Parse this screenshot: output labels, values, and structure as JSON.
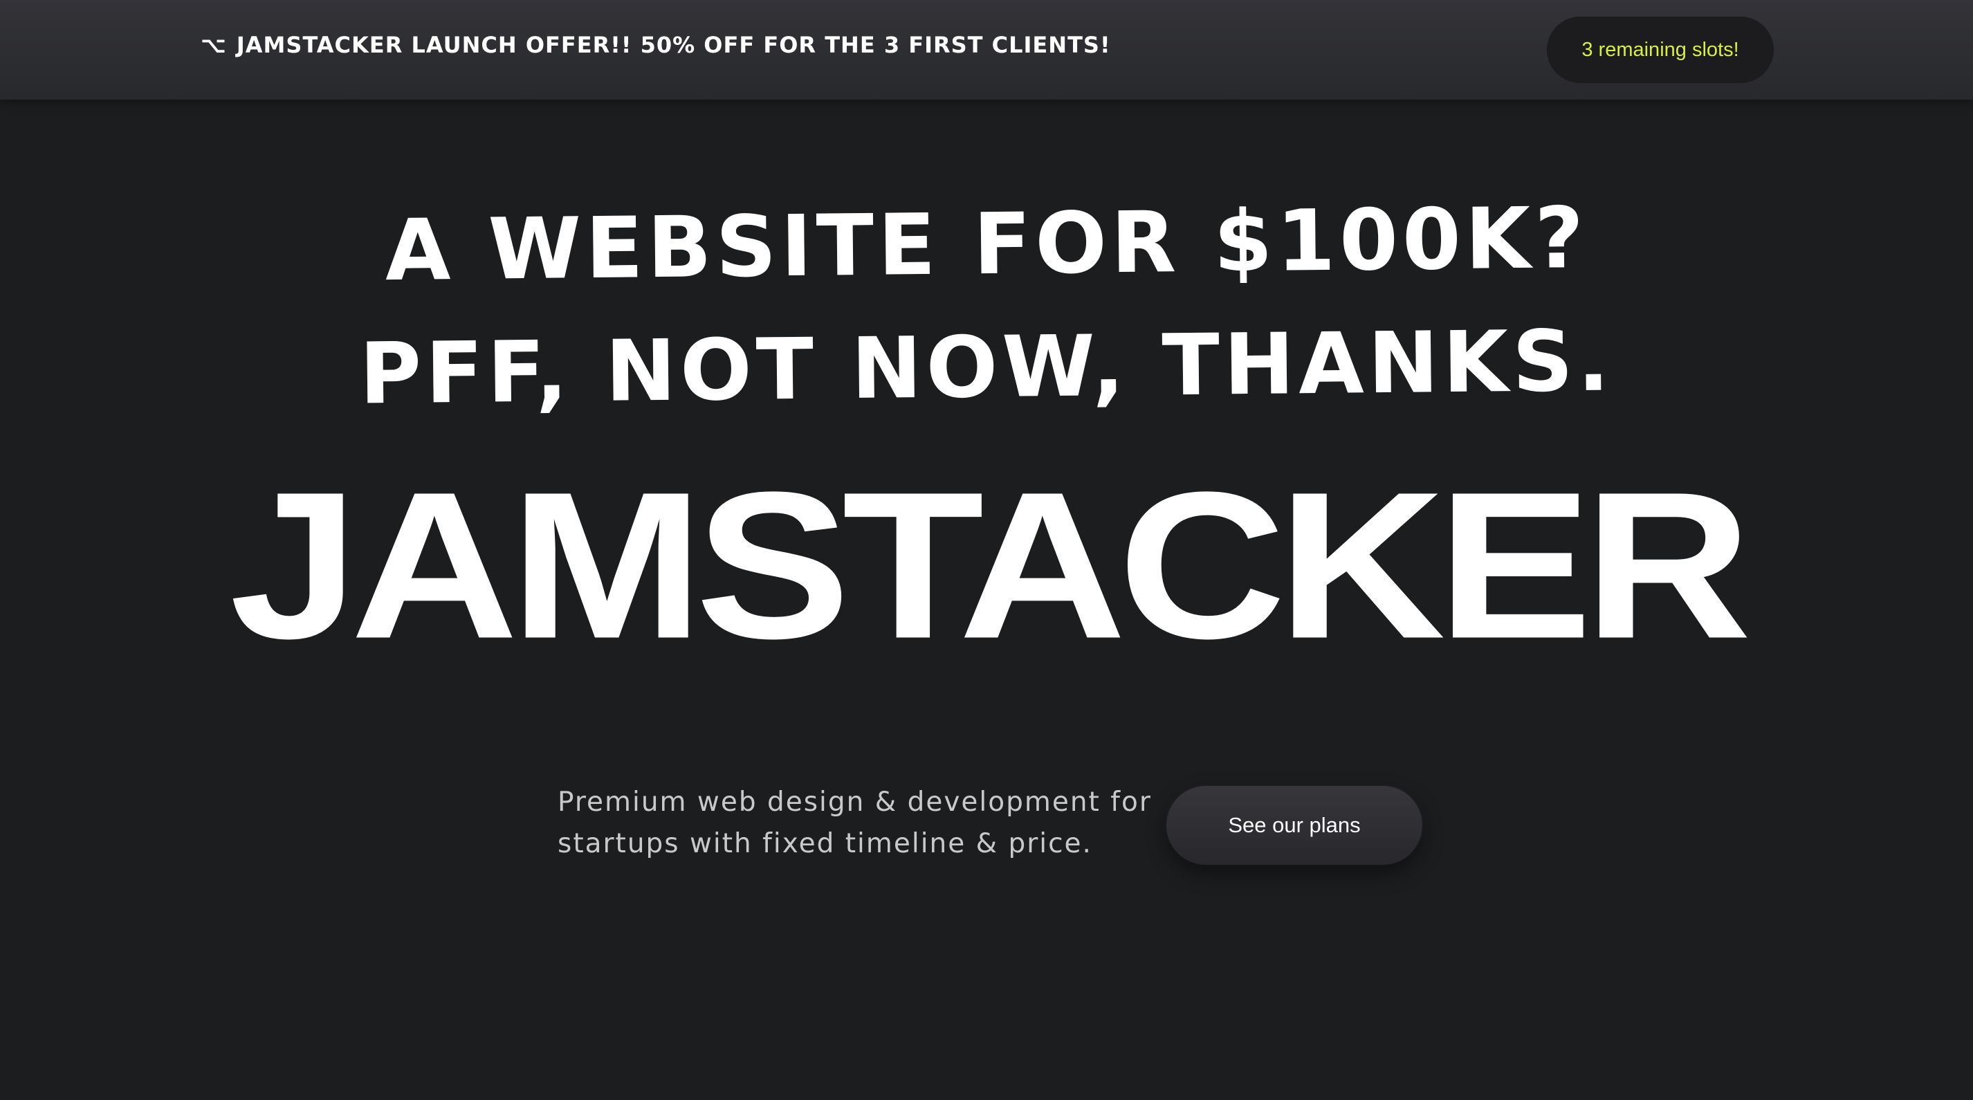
{
  "announcement": {
    "icon": "option-key-icon",
    "icon_glyph": "⌥",
    "text": "JAMSTACKER LAUNCH OFFER!! 50% OFF FOR THE 3 FIRST CLIENTS!",
    "badge": "3 remaining slots!",
    "badge_color": "#d6f03c"
  },
  "hero": {
    "headline_line1": "A WEBSITE FOR $100K?",
    "headline_line2": "PFF, NOT NOW, THANKS.",
    "brand": "JAMSTACKER",
    "tagline_line1": "Premium web design & development for",
    "tagline_line2": "startups with fixed timeline & price.",
    "cta_label": "See our plans"
  },
  "colors": {
    "background": "#1c1d1f",
    "topbar": "#2d2e32",
    "text": "#ffffff",
    "accent": "#d6f03c"
  }
}
